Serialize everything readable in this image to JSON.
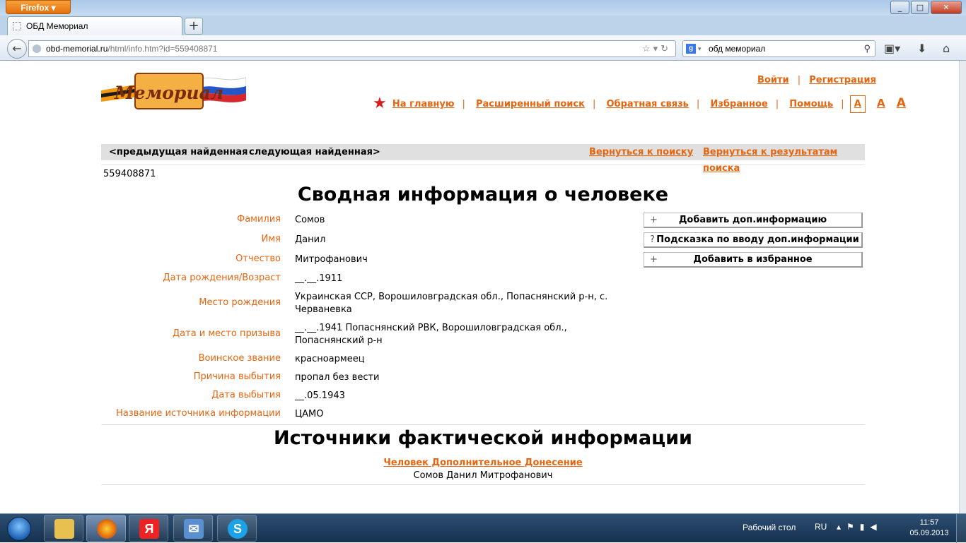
{
  "browser": {
    "menu_button": "Firefox",
    "tab_title": "ОБД Мемориал",
    "new_tab": "+",
    "url_domain": "obd-memorial.ru",
    "url_path": "/html/info.htm?id=559408871",
    "search_engine": "g",
    "search_value": "обд мемориал",
    "window_controls": [
      "_",
      "□",
      "✕"
    ]
  },
  "header": {
    "logo_text": "Мемориал",
    "login": "Войти",
    "register": "Регистрация",
    "nav": [
      "На главную",
      "Расширенный поиск",
      "Обратная связь",
      "Избранное",
      "Помощь"
    ],
    "font_sizes": [
      "A",
      "A",
      "A"
    ]
  },
  "crumbs": {
    "prev": "<предыдущая найденная",
    "next": "следующая найденная>",
    "back_search": "Вернуться к поиску",
    "back_results": "Вернуться к результатам поиска"
  },
  "record": {
    "id": "559408871",
    "title": "Сводная информация о человеке",
    "fields": [
      {
        "label": "Фамилия",
        "value": "Сомов"
      },
      {
        "label": "Имя",
        "value": "Данил"
      },
      {
        "label": "Отчество",
        "value": "Митрофанович"
      },
      {
        "label": "Дата рождения/Возраст",
        "value": "__.__.1911"
      },
      {
        "label": "Место рождения",
        "value": "Украинская ССР, Ворошиловградская обл., Попаснянский р-н, с. Черваневка"
      },
      {
        "label": "Дата и место призыва",
        "value": "__.__.1941 Попаснянский РВК, Ворошиловградская обл., Попаснянский р-н"
      },
      {
        "label": "Воинское звание",
        "value": "красноармеец"
      },
      {
        "label": "Причина выбытия",
        "value": "пропал без вести"
      },
      {
        "label": "Дата выбытия",
        "value": "__.05.1943"
      },
      {
        "label": "Название источника информации",
        "value": "ЦАМО"
      }
    ],
    "actions": [
      {
        "prefix": "+",
        "label": "Добавить доп.информацию"
      },
      {
        "prefix": "?",
        "label": "Подсказка по вводу доп.информации"
      },
      {
        "prefix": "+",
        "label": "Добавить в избранное"
      }
    ]
  },
  "sources": {
    "title": "Источники фактической информации",
    "link": "Человек Дополнительное Донесение",
    "name": "Сомов Данил Митрофанович"
  },
  "taskbar": {
    "apps": [
      "explorer",
      "firefox",
      "yandex",
      "mail",
      "skype"
    ],
    "desktop_label": "Рабочий стол",
    "lang": "RU",
    "time": "11:57",
    "date": "05.09.2013"
  },
  "colors": {
    "accent": "#e8650e",
    "star": "#d81e1e"
  }
}
